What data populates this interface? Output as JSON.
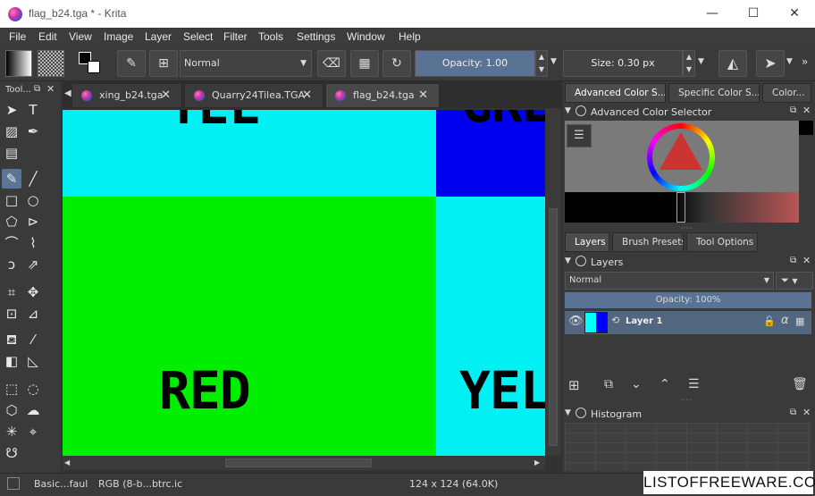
{
  "window": {
    "title": "flag_b24.tga * - Krita",
    "minimize": "—",
    "maximize": "☐",
    "close": "✕"
  },
  "menu": [
    "File",
    "Edit",
    "View",
    "Image",
    "Layer",
    "Select",
    "Filter",
    "Tools",
    "Settings",
    "Window",
    "Help"
  ],
  "toolbar": {
    "blend_mode": "Normal",
    "opacity_label": "Opacity:",
    "opacity_value": "1.00",
    "size_label": "Size:",
    "size_value": "0.30 px"
  },
  "toolbox": {
    "title": "Tool..."
  },
  "tabs": [
    {
      "label": "xing_b24.tga"
    },
    {
      "label": "Quarry24Tilea.TGA"
    },
    {
      "label": "flag_b24.tga"
    }
  ],
  "canvas": {
    "texts": {
      "top_left": "YEL",
      "top_right": "GRE",
      "bottom_left": "RED",
      "bottom_right": "YEL"
    },
    "colors": {
      "cyan": "#00f0f4",
      "blue": "#0000ee",
      "green": "#00ee00"
    }
  },
  "dock": {
    "color_tabs": [
      "Advanced Color S...",
      "Specific Color S...",
      "Color..."
    ],
    "color_selector_title": "Advanced Color Selector",
    "layer_tabs": [
      "Layers",
      "Brush Presets",
      "Tool Options"
    ],
    "layers_title": "Layers",
    "layer_blend": "Normal",
    "layer_opacity": "Opacity:  100%",
    "layer_name": "Layer 1",
    "histogram_title": "Histogram"
  },
  "status": {
    "brush": "Basic...faul",
    "colorspace": "RGB (8-b...btrc.ic",
    "dimensions": "124 x 124 (64.0K)"
  },
  "watermark": "LISTOFFREEWARE.COM"
}
